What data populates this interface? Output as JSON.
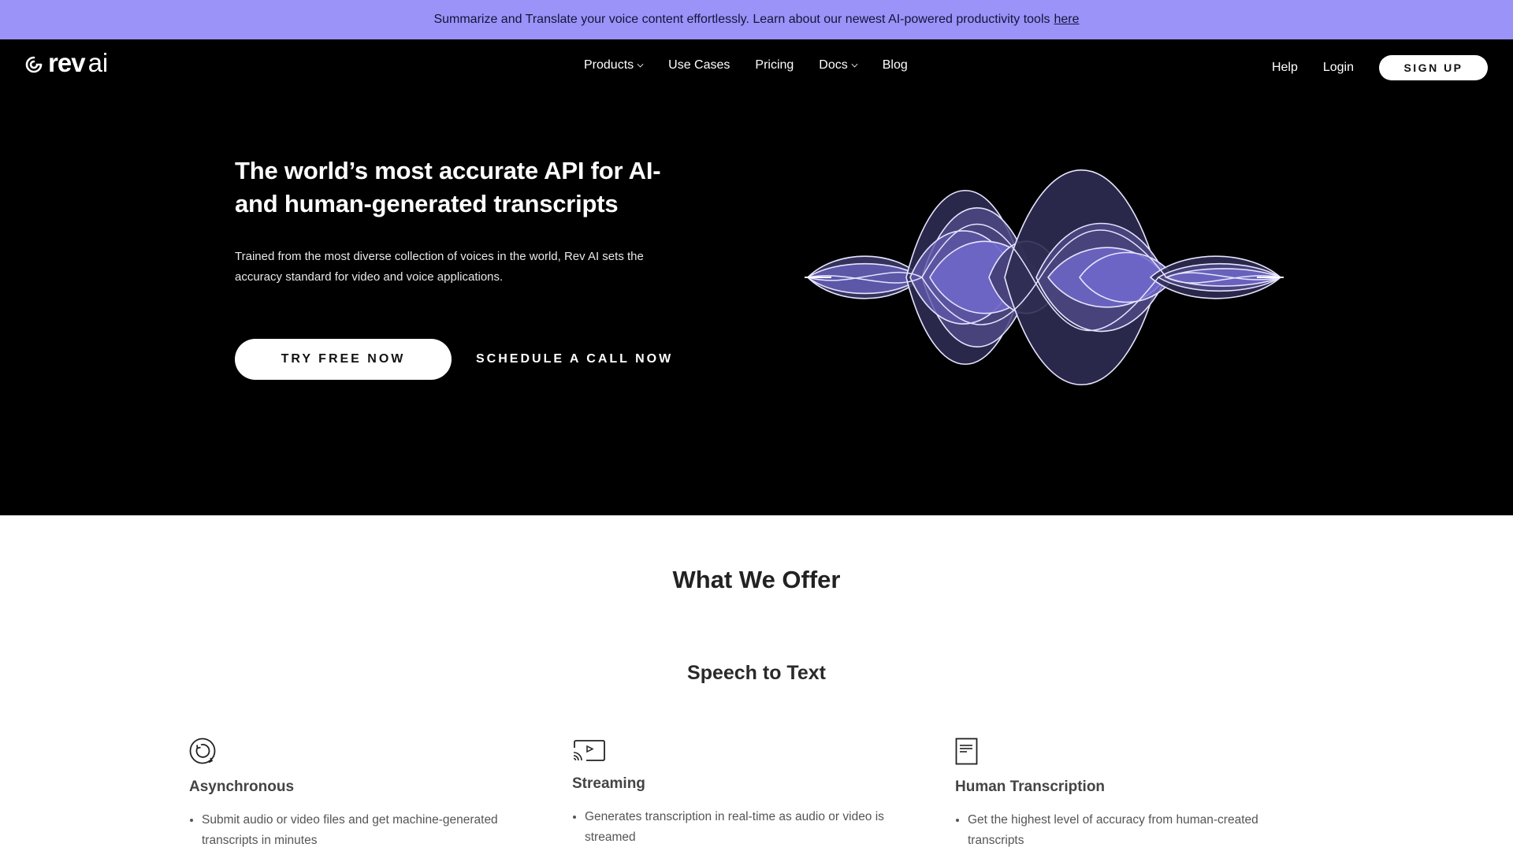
{
  "banner": {
    "text": "Summarize and Translate your voice content effortlessly. Learn about our newest AI-powered productivity tools",
    "link_label": "here",
    "color": "#9b93f8"
  },
  "header": {
    "logo": {
      "word1": "rev",
      "word2": "ai"
    },
    "nav": [
      {
        "label": "Products",
        "has_dropdown": true
      },
      {
        "label": "Use Cases",
        "has_dropdown": false
      },
      {
        "label": "Pricing",
        "has_dropdown": false
      },
      {
        "label": "Docs",
        "has_dropdown": true
      },
      {
        "label": "Blog",
        "has_dropdown": false
      }
    ],
    "help_label": "Help",
    "login_label": "Login",
    "signup_label": "SIGN UP"
  },
  "hero": {
    "title": "The world’s most accurate API for AI- and human-generated transcripts",
    "subtitle": "Trained from the most diverse collection of voices in the world, Rev AI sets the accuracy standard for video and voice applications.",
    "primary_cta": "TRY FREE NOW",
    "secondary_cta": "SCHEDULE A CALL NOW",
    "illustration": "sound-waveform",
    "accent": "#6e67c8"
  },
  "offer": {
    "title": "What We Offer",
    "subtitle": "Speech to Text",
    "features": [
      {
        "icon": "sync-icon",
        "title": "Asynchronous",
        "bullets": [
          "Submit audio or video files and get machine-generated transcripts in minutes"
        ]
      },
      {
        "icon": "cast-stream-icon",
        "title": "Streaming",
        "bullets": [
          "Generates transcription in real-time as audio or video is streamed"
        ]
      },
      {
        "icon": "document-icon",
        "title": "Human Transcription",
        "bullets": [
          "Get the highest level of accuracy from human-created transcripts"
        ]
      }
    ]
  }
}
